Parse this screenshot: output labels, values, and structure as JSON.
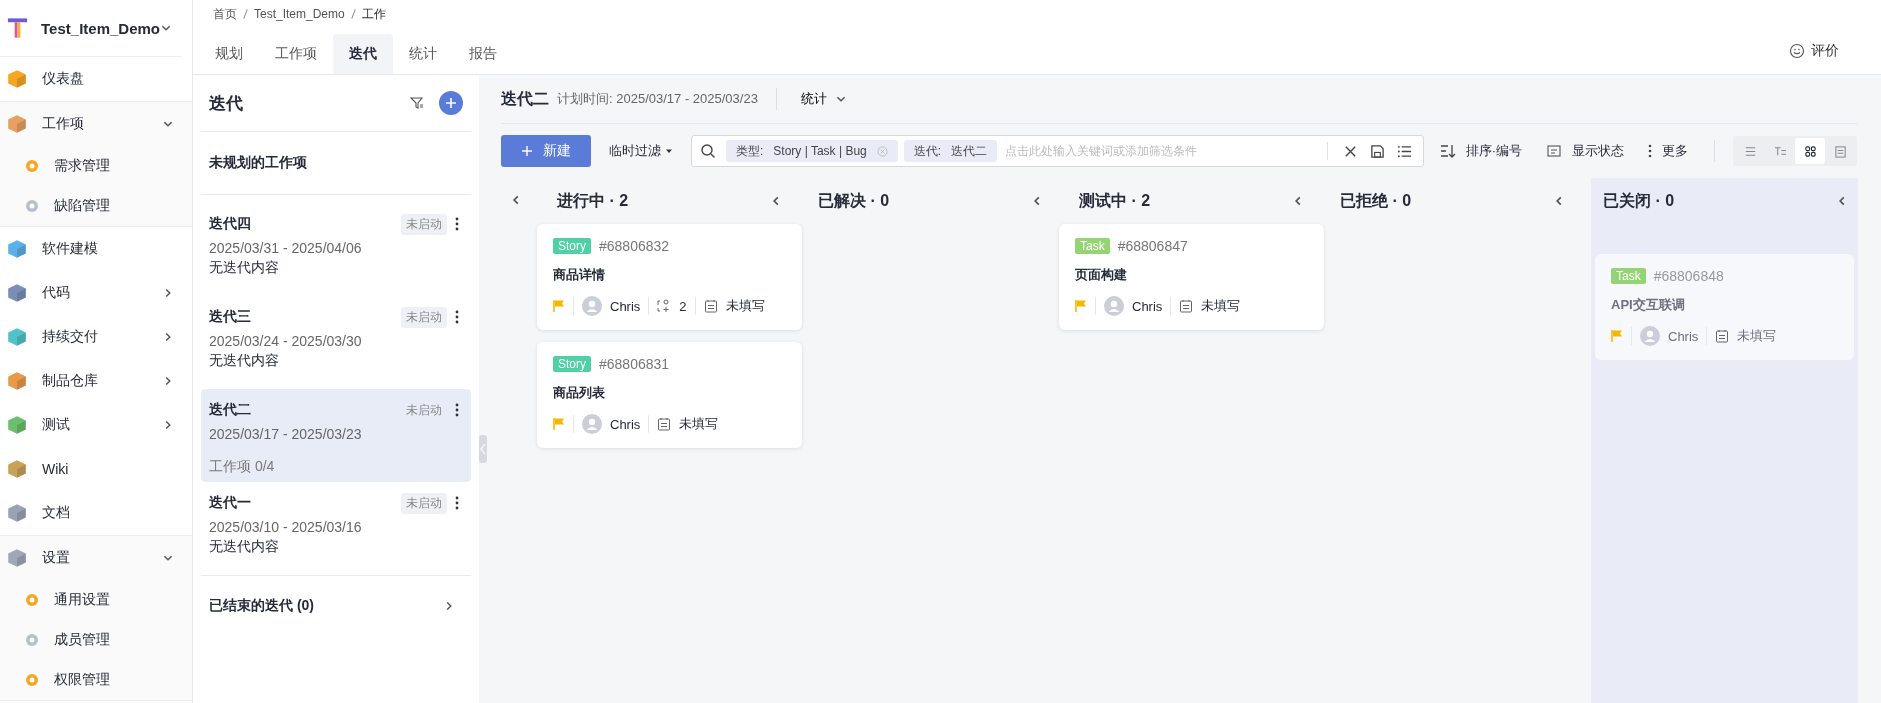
{
  "project": {
    "name": "Test_Item_Demo"
  },
  "sidebar": {
    "items": [
      {
        "label": "仪表盘"
      },
      {
        "label": "工作项",
        "expanded": true,
        "children": [
          {
            "label": "需求管理"
          },
          {
            "label": "缺陷管理"
          }
        ]
      },
      {
        "label": "软件建模"
      },
      {
        "label": "代码",
        "expanded": false
      },
      {
        "label": "持续交付",
        "expanded": false
      },
      {
        "label": "制品仓库",
        "expanded": false
      },
      {
        "label": "测试",
        "expanded": false
      },
      {
        "label": "Wiki"
      },
      {
        "label": "文档"
      },
      {
        "label": "设置",
        "expanded": true,
        "children": [
          {
            "label": "通用设置"
          },
          {
            "label": "成员管理"
          },
          {
            "label": "权限管理"
          }
        ]
      }
    ]
  },
  "breadcrumb": [
    "首页",
    "Test_Item_Demo",
    "工作"
  ],
  "tabs": [
    {
      "label": "规划",
      "selected": false
    },
    {
      "label": "工作项",
      "selected": false
    },
    {
      "label": "迭代",
      "selected": true
    },
    {
      "label": "统计",
      "selected": false
    },
    {
      "label": "报告",
      "selected": false
    }
  ],
  "feedback": {
    "label": "评价"
  },
  "iteration_panel": {
    "title": "迭代",
    "unplanned": "未规划的工作项",
    "iterations": [
      {
        "name": "迭代四",
        "status": "未启动",
        "dates": "2025/03/31 - 2025/04/06",
        "note": "无迭代内容",
        "selected": false
      },
      {
        "name": "迭代三",
        "status": "未启动",
        "dates": "2025/03/24 - 2025/03/30",
        "note": "无迭代内容",
        "selected": false
      },
      {
        "name": "迭代二",
        "status": "未启动",
        "dates": "2025/03/17 - 2025/03/23",
        "note": "工作项 0/4",
        "selected": true
      },
      {
        "name": "迭代一",
        "status": "未启动",
        "dates": "2025/03/10 - 2025/03/16",
        "note": "无迭代内容",
        "selected": false
      }
    ],
    "ended": "已结束的迭代 (0)"
  },
  "header": {
    "title": "迭代二",
    "plan_time": "计划时间: 2025/03/17 - 2025/03/23",
    "stats": "统计"
  },
  "toolbar": {
    "new_button": "新建",
    "quick_filter": "临时过滤",
    "chips": [
      {
        "label": "类型:",
        "value": "Story  |  Task  |  Bug",
        "clearable": true
      },
      {
        "label": "迭代:",
        "value": "迭代二",
        "clearable": false
      }
    ],
    "search_placeholder": "点击此处输入关键词或添加筛选条件",
    "sort": "排序·编号",
    "show_status": "显示状态",
    "more": "更多",
    "views": [
      {
        "selected": false
      },
      {
        "selected": false
      },
      {
        "selected": true
      },
      {
        "selected": false
      }
    ]
  },
  "board": {
    "columns": [
      {
        "title": "进行中 · 2",
        "selected": false,
        "cards": [
          {
            "tag": {
              "label": "Story",
              "color": "#4fd1a5"
            },
            "id": "#68806832",
            "title": "商品详情",
            "assignee": "Chris",
            "subtasks": "2",
            "due": "未填写"
          },
          {
            "tag": {
              "label": "Story",
              "color": "#4fd1a5"
            },
            "id": "#68806831",
            "title": "商品列表",
            "assignee": "Chris",
            "due": "未填写"
          }
        ]
      },
      {
        "title": "已解决 · 0",
        "selected": false
      },
      {
        "title": "测试中 · 2",
        "selected": false,
        "cards": [
          {
            "tag": {
              "label": "Task",
              "color": "#95d475"
            },
            "id": "#68806847",
            "title": "页面构建",
            "assignee": "Chris",
            "due": "未填写"
          }
        ]
      },
      {
        "title": "已拒绝 · 0",
        "selected": false
      },
      {
        "title": "已关闭 · 0",
        "selected": true,
        "cards": [
          {
            "tag": {
              "label": "Task",
              "color": "#95d475"
            },
            "id": "#68806848",
            "title": "API交互联调",
            "assignee": "Chris",
            "due": "未填写"
          }
        ]
      }
    ]
  }
}
